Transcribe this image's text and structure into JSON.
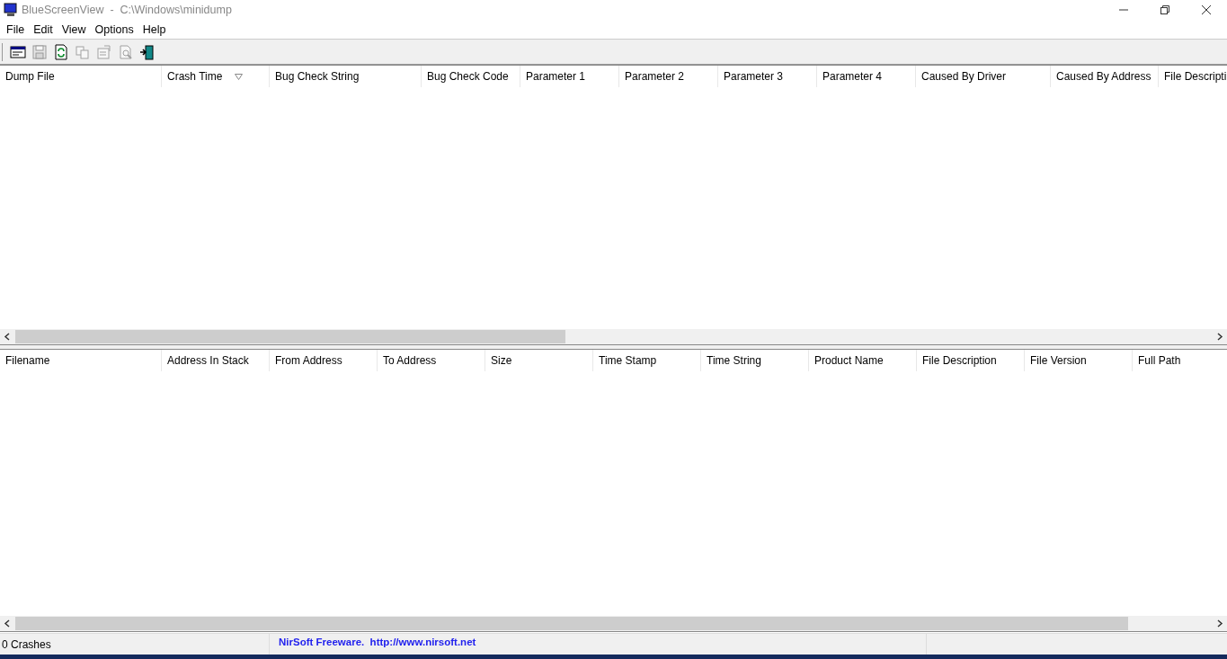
{
  "window": {
    "title": "BlueScreenView  -  C:\\Windows\\minidump"
  },
  "menu": [
    "File",
    "Edit",
    "View",
    "Options",
    "Help"
  ],
  "toolbar": [
    {
      "kind": "options",
      "disabled": false
    },
    {
      "kind": "save",
      "disabled": true
    },
    {
      "kind": "refresh",
      "disabled": false
    },
    {
      "kind": "copy",
      "disabled": true
    },
    {
      "kind": "properties",
      "disabled": true
    },
    {
      "kind": "find",
      "disabled": true
    },
    {
      "kind": "exit",
      "disabled": false
    }
  ],
  "crash_table": {
    "columns": [
      {
        "label": "Dump File",
        "sorted": false
      },
      {
        "label": "Crash Time",
        "sorted": true
      },
      {
        "label": "Bug Check String",
        "sorted": false
      },
      {
        "label": "Bug Check Code",
        "sorted": false
      },
      {
        "label": "Parameter 1",
        "sorted": false
      },
      {
        "label": "Parameter 2",
        "sorted": false
      },
      {
        "label": "Parameter 3",
        "sorted": false
      },
      {
        "label": "Parameter 4",
        "sorted": false
      },
      {
        "label": "Caused By Driver",
        "sorted": false
      },
      {
        "label": "Caused By Address",
        "sorted": false
      },
      {
        "label": "File Descripti",
        "sorted": false
      }
    ]
  },
  "driver_table": {
    "columns": [
      {
        "label": "Filename",
        "sorted": false
      },
      {
        "label": "Address In Stack",
        "sorted": false
      },
      {
        "label": "From Address",
        "sorted": false
      },
      {
        "label": "To Address",
        "sorted": false
      },
      {
        "label": "Size",
        "sorted": false
      },
      {
        "label": "Time Stamp",
        "sorted": false
      },
      {
        "label": "Time String",
        "sorted": false
      },
      {
        "label": "Product Name",
        "sorted": false
      },
      {
        "label": "File Description",
        "sorted": false
      },
      {
        "label": "File Version",
        "sorted": false
      },
      {
        "label": "Full Path",
        "sorted": false
      }
    ]
  },
  "status_bar": {
    "count": "0 Crashes",
    "credit": "NirSoft Freeware.  http://www.nirsoft.net"
  }
}
